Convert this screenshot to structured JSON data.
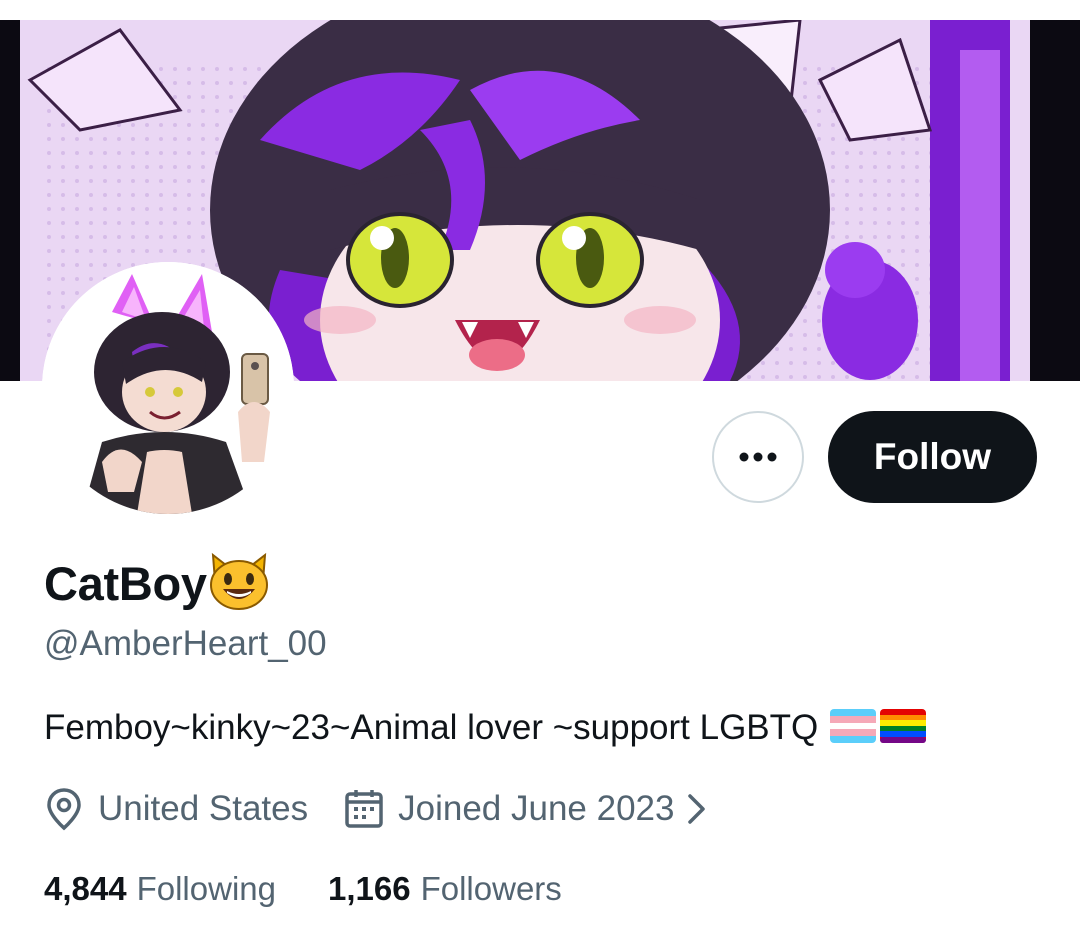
{
  "profile": {
    "display_name": "CatBoy",
    "name_emoji_icon": "smiling-cat-emoji",
    "handle": "@AmberHeart_00",
    "bio": "Femboy~kinky~23~Animal lover ~support LGBTQ",
    "bio_flags": [
      "transgender-flag",
      "rainbow-flag"
    ]
  },
  "actions": {
    "more_icon": "more-dots-icon",
    "follow_label": "Follow"
  },
  "meta": {
    "location_icon": "location-pin-icon",
    "location": "United States",
    "joined_icon": "calendar-icon",
    "joined": "Joined June 2023",
    "joined_chevron_icon": "chevron-right-icon"
  },
  "stats": {
    "following_count": "4,844",
    "following_label": "Following",
    "followers_count": "1,166",
    "followers_label": "Followers"
  },
  "colors": {
    "text_primary": "#0f1419",
    "text_secondary": "#536471",
    "button_dark": "#0f1419",
    "border": "#cfd9de",
    "banner_purple": "#8a2be2"
  }
}
